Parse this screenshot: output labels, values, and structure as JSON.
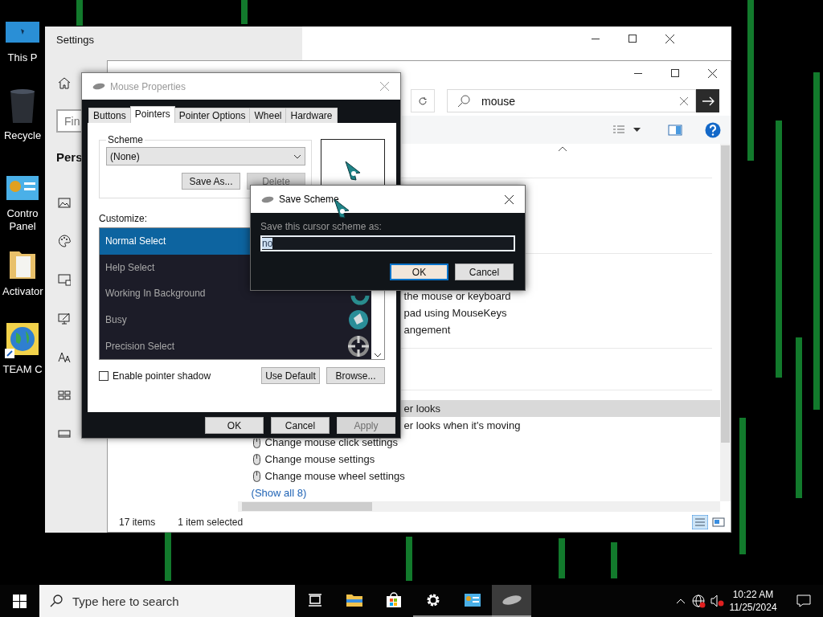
{
  "desktop_icons": [
    {
      "label": "This P",
      "kind": "monitor"
    },
    {
      "label": "Recycle",
      "kind": "bin"
    },
    {
      "label": "Contro Panel",
      "kind": "panel"
    },
    {
      "label": "Activator",
      "kind": "folder"
    },
    {
      "label": "TEAM C",
      "kind": "globe"
    }
  ],
  "settings": {
    "title": "Settings",
    "search_placeholder": "Fin",
    "heading": "Pers"
  },
  "control_panel": {
    "search": "mouse",
    "groups": [
      [
        {
          "kind": "clipped",
          "text": "the mouse or keyboard",
          "selected": false
        },
        {
          "kind": "clipped",
          "text": "pad using MouseKeys",
          "selected": false
        },
        {
          "kind": "clipped",
          "text": "angement",
          "selected": false
        }
      ],
      [
        {
          "kind": "clipped",
          "text": "er looks",
          "selected": true
        },
        {
          "kind": "clipped",
          "text": "er looks when it's moving",
          "selected": false
        },
        {
          "kind": "task",
          "text": "Change mouse click settings",
          "selected": false
        },
        {
          "kind": "task",
          "text": "Change mouse settings",
          "selected": false
        },
        {
          "kind": "task",
          "text": "Change mouse wheel settings",
          "selected": false
        }
      ]
    ],
    "show_all": "(Show all 8)",
    "status": [
      "17 items",
      "1 item selected"
    ]
  },
  "mouse_properties": {
    "title": "Mouse Properties",
    "tabs": [
      {
        "label": "Buttons",
        "selected": false
      },
      {
        "label": "Pointers",
        "selected": true
      },
      {
        "label": "Pointer Options",
        "selected": false
      },
      {
        "label": "Wheel",
        "selected": false
      },
      {
        "label": "Hardware",
        "selected": false
      }
    ],
    "scheme_legend": "Scheme",
    "scheme_value": "(None)",
    "save_as": {
      "label": "Save As...",
      "disabled": false
    },
    "delete": {
      "label": "Delete",
      "disabled": true
    },
    "customize_label": "Customize:",
    "pointers": [
      {
        "name": "Normal Select",
        "kind": "none",
        "selected": true
      },
      {
        "name": "Help Select",
        "kind": "none",
        "selected": false
      },
      {
        "name": "Working In Background",
        "kind": "ring",
        "selected": false
      },
      {
        "name": "Busy",
        "kind": "busy",
        "selected": false
      },
      {
        "name": "Precision Select",
        "kind": "crosshair",
        "selected": false
      }
    ],
    "shadow": {
      "label": "Enable pointer shadow",
      "checked": false
    },
    "use_default": "Use Default",
    "browse": "Browse...",
    "buttons": [
      {
        "label": "OK",
        "disabled": false
      },
      {
        "label": "Cancel",
        "disabled": false
      },
      {
        "label": "Apply",
        "disabled": true
      }
    ]
  },
  "save_scheme": {
    "title": "Save Scheme",
    "prompt": "Save this cursor scheme as:",
    "value": "no",
    "buttons": [
      {
        "label": "OK",
        "default": true
      },
      {
        "label": "Cancel",
        "default": false
      }
    ]
  },
  "taskbar": {
    "search_placeholder": "Type here to search",
    "apps": [
      {
        "kind": "taskview",
        "open": false,
        "active": false
      },
      {
        "kind": "folder",
        "open": false,
        "active": false
      },
      {
        "kind": "store",
        "open": false,
        "active": false
      },
      {
        "kind": "gear",
        "open": true,
        "active": false
      },
      {
        "kind": "panel",
        "open": true,
        "active": false
      },
      {
        "kind": "mouse",
        "open": true,
        "active": true
      }
    ],
    "time": "10:22 AM",
    "date": "11/25/2024"
  }
}
